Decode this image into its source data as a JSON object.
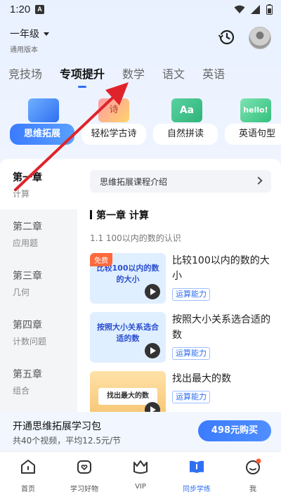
{
  "status": {
    "time": "1:20",
    "notif": "A"
  },
  "header": {
    "grade": "一年级",
    "edition": "通用版本"
  },
  "tabs": [
    {
      "label": "竞技场",
      "active": false
    },
    {
      "label": "专项提升",
      "active": true
    },
    {
      "label": "数学",
      "active": false
    },
    {
      "label": "语文",
      "active": false
    },
    {
      "label": "英语",
      "active": false
    }
  ],
  "topics": [
    {
      "label": "思维拓展",
      "active": true
    },
    {
      "label": "轻松学古诗",
      "active": false
    },
    {
      "label": "自然拼读",
      "active": false
    },
    {
      "label": "英语句型",
      "active": false
    }
  ],
  "topic_deco_text": {
    "poem": "诗",
    "aa": "Aa",
    "hello": "hello!"
  },
  "chapters": [
    {
      "title": "第一章",
      "sub": "计算",
      "active": true
    },
    {
      "title": "第二章",
      "sub": "应用题",
      "active": false
    },
    {
      "title": "第三章",
      "sub": "几何",
      "active": false
    },
    {
      "title": "第四章",
      "sub": "计数问题",
      "active": false
    },
    {
      "title": "第五章",
      "sub": "组合",
      "active": false
    }
  ],
  "intro": {
    "label": "思维拓展课程介绍"
  },
  "section": {
    "heading": "第一章  计算",
    "subsection": "1.1  100以内的数的认识"
  },
  "lessons": [
    {
      "thumb_text": "比较100以内的数的大小",
      "free_badge": "免费",
      "title": "比较100以内的数的大小",
      "tag": "运算能力"
    },
    {
      "thumb_text": "按照大小关系选合适的数",
      "free_badge": "",
      "title": "按照大小关系选合适的数",
      "tag": "运算能力"
    },
    {
      "thumb_text": "找出最大的数",
      "free_badge": "",
      "title": "找出最大的数",
      "tag": "运算能力"
    }
  ],
  "purchase": {
    "title": "开通思维拓展学习包",
    "desc": "共40个视频，平均12.5元/节",
    "button": "498元购买"
  },
  "bottom_nav": [
    {
      "label": "首页",
      "icon": "home-icon",
      "active": false
    },
    {
      "label": "学习好物",
      "icon": "bag-heart-icon",
      "active": false
    },
    {
      "label": "VIP",
      "icon": "vip-crown-icon",
      "active": false
    },
    {
      "label": "同步学练",
      "icon": "book-icon",
      "active": true
    },
    {
      "label": "我",
      "icon": "smile-profile-icon",
      "active": false
    }
  ],
  "colors": {
    "accent": "#2f6ff2",
    "annotation": "#e0232a",
    "free_badge": "#ff6a3d"
  }
}
